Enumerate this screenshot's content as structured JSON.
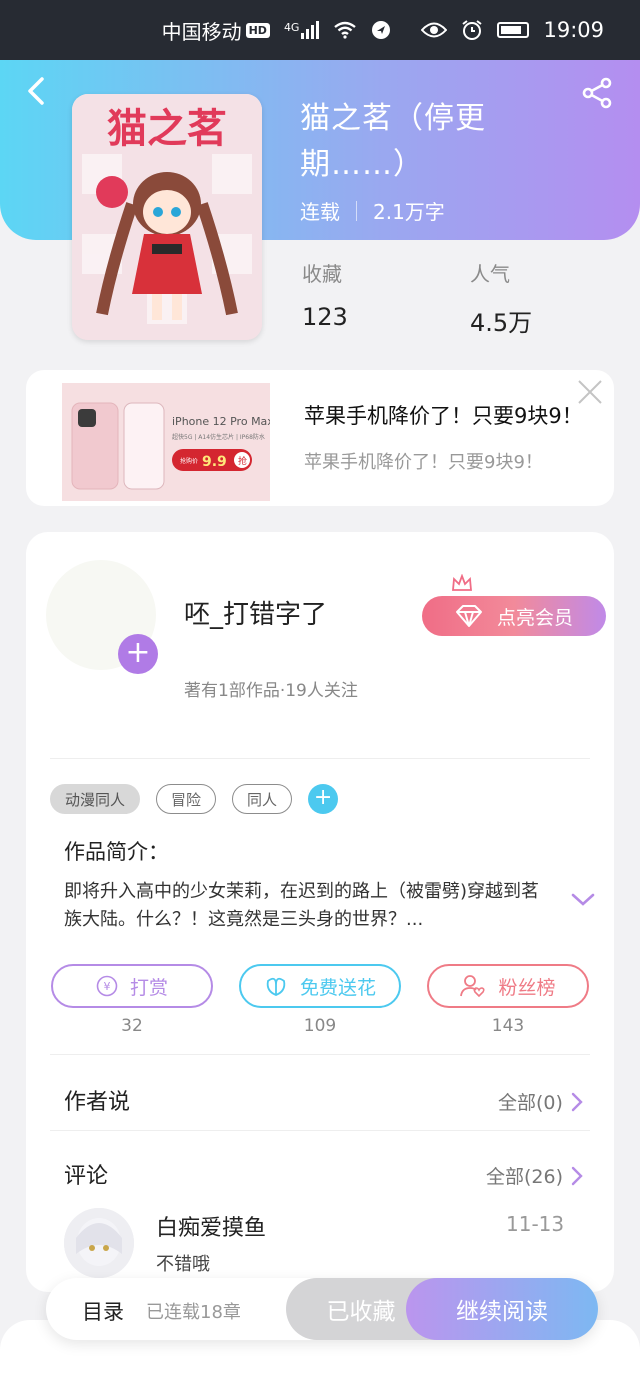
{
  "status_bar": {
    "carrier": "中国移动",
    "hd_badge": "HD",
    "network": "4G",
    "time": "19:09"
  },
  "book": {
    "title": "猫之茗（停更期……）",
    "status": "连载",
    "word_count": "2.1万字",
    "stats": [
      {
        "label": "收藏",
        "value": "123"
      },
      {
        "label": "人气",
        "value": "4.5万"
      }
    ],
    "cover_title": "猫之茗"
  },
  "ad": {
    "image_text": "iPhone 12 Pro Max",
    "image_subtext": "超快5G | A14仿生芯片 | IP68防水",
    "image_price_label": "抢购价",
    "image_price": "9.9",
    "image_price_action": "抢",
    "title": "苹果手机降价了！只要9块9！",
    "subtitle": "苹果手机降价了！只要9块9！"
  },
  "author": {
    "name": "呸_打错字了",
    "info": "著有1部作品·19人关注",
    "vip_label": "点亮会员"
  },
  "tags": [
    "动漫同人",
    "冒险",
    "同人"
  ],
  "intro": {
    "title": "作品简介：",
    "text": "即将升入高中的少女茉莉，在迟到的路上（被雷劈)穿越到茗族大陆。什么？！这竟然是三头身的世界？..."
  },
  "actions": [
    {
      "label": "打赏",
      "count": "32",
      "color": "#b58be6"
    },
    {
      "label": "免费送花",
      "count": "109",
      "color": "#4cc9ef"
    },
    {
      "label": "粉丝榜",
      "count": "143",
      "color": "#ef7b86"
    }
  ],
  "author_says": {
    "title": "作者说",
    "link": "全部(0)"
  },
  "comments": {
    "title": "评论",
    "link": "全部(26)",
    "items": [
      {
        "user": "白痴爱摸鱼",
        "date": "11-13",
        "text": "不错哦"
      }
    ]
  },
  "bottom_bar": {
    "toc_label": "目录",
    "toc_count": "已连载18章",
    "collected_label": "已收藏",
    "read_label": "继续阅读"
  },
  "colors": {
    "accent_purple": "#b07be6",
    "accent_cyan": "#4cc9ef",
    "accent_pink": "#ef7b86"
  }
}
